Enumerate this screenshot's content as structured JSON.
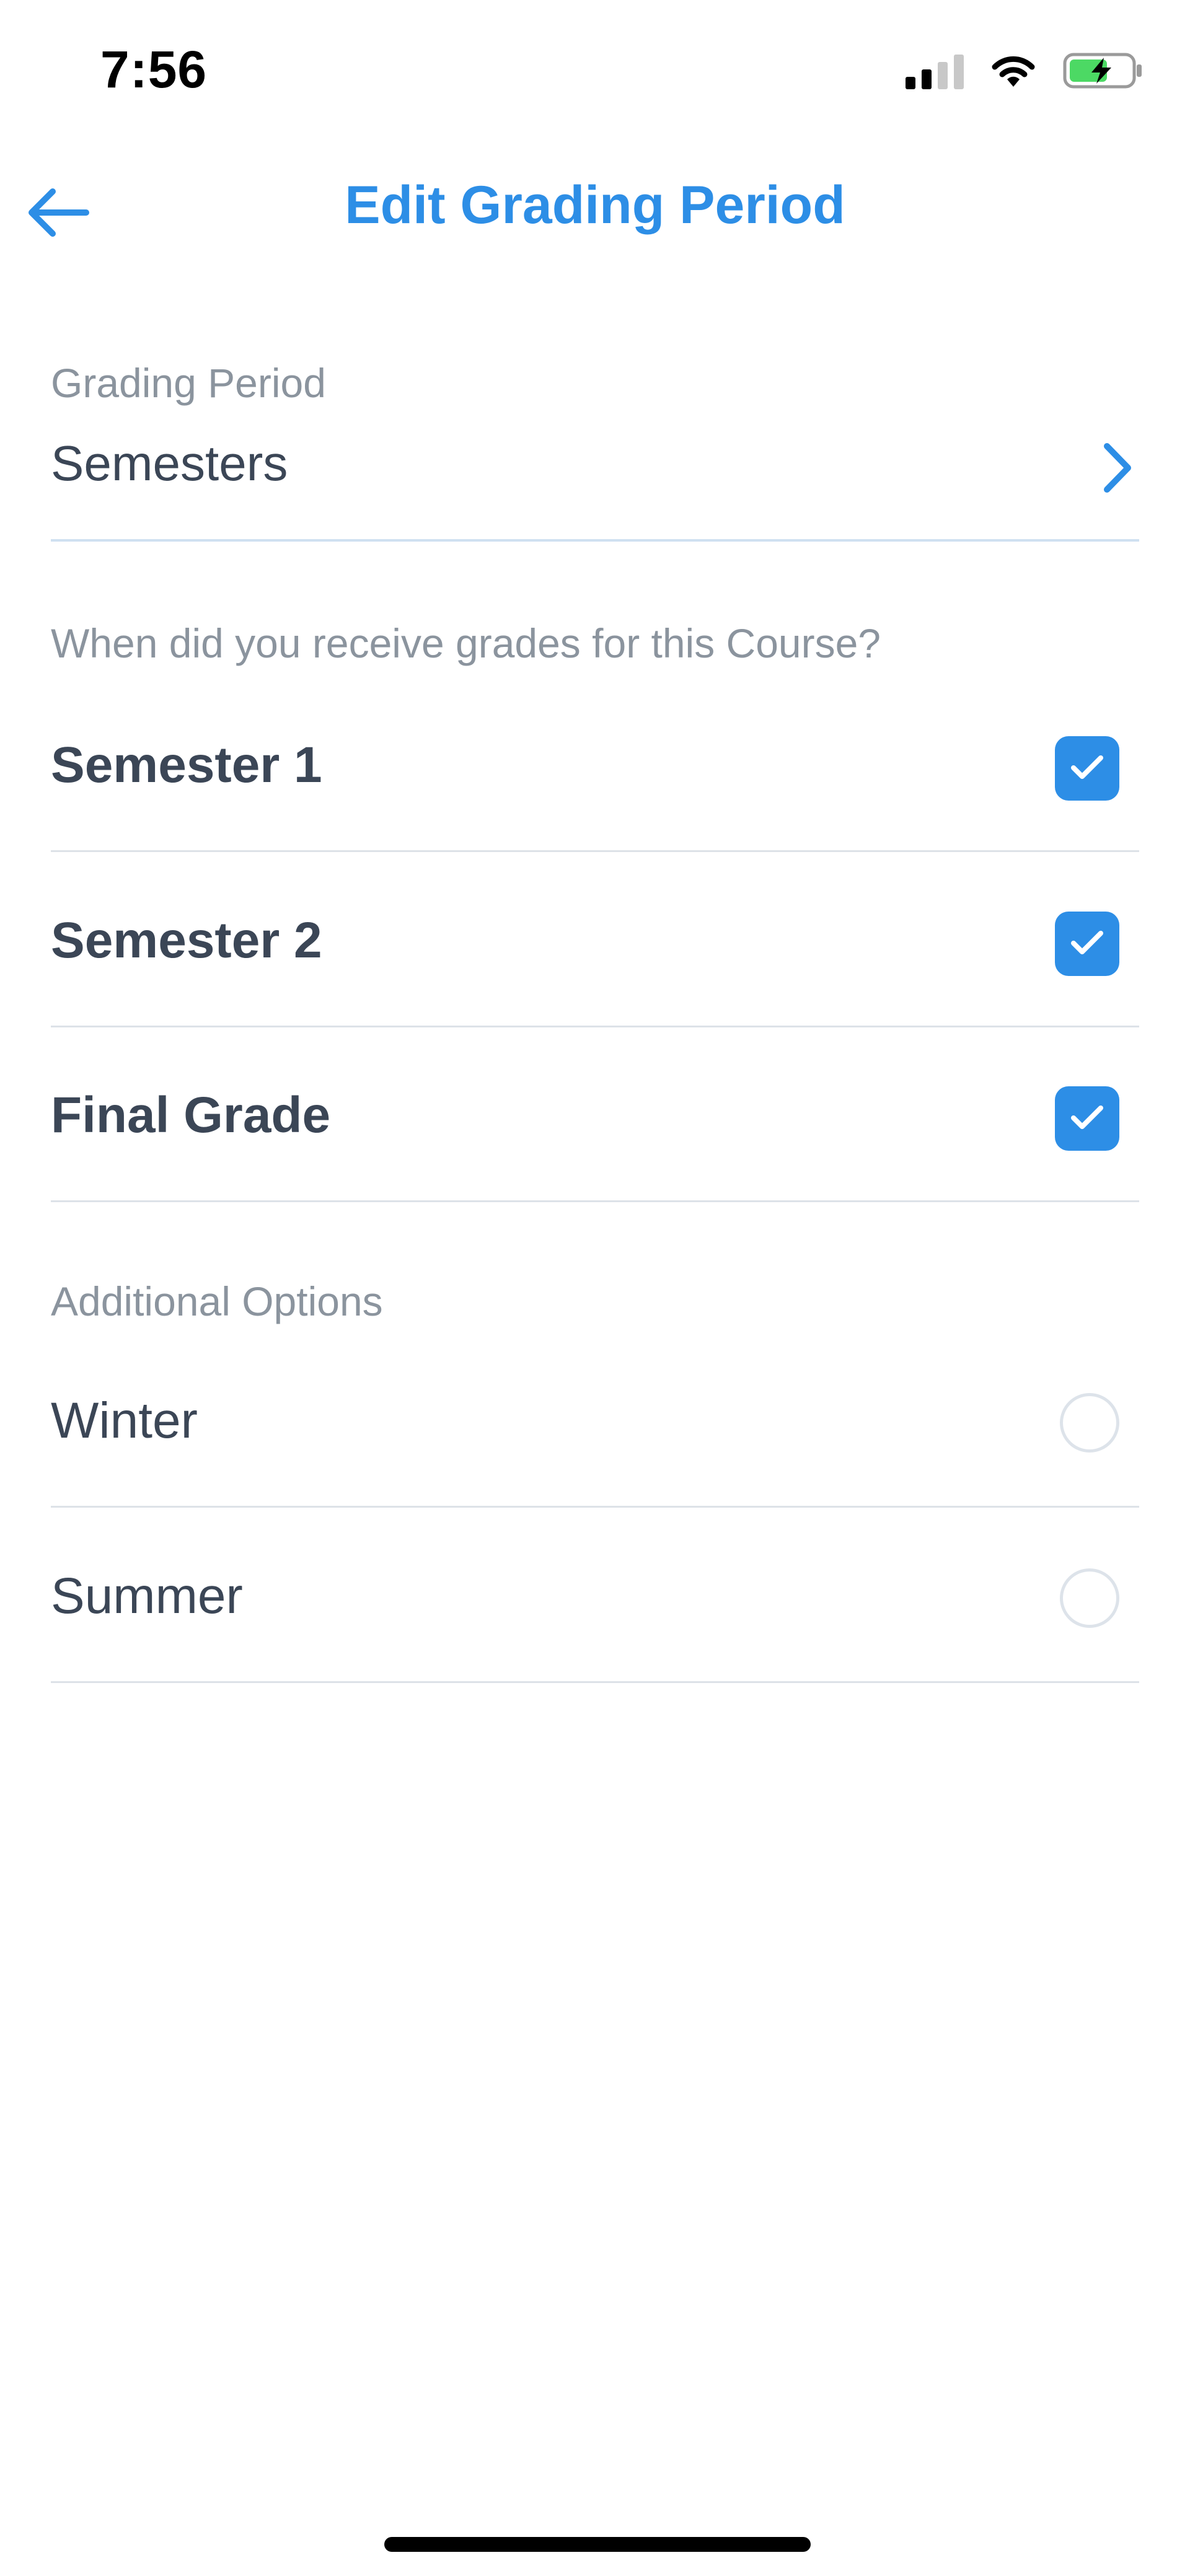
{
  "status_bar": {
    "time": "7:56",
    "signal_icon": "signal-icon",
    "wifi_icon": "wifi-icon",
    "battery_icon": "battery-charging-icon"
  },
  "nav": {
    "back_icon": "arrow-left-icon",
    "title": "Edit Grading Period"
  },
  "grading_period": {
    "label": "Grading Period",
    "value": "Semesters",
    "chevron_icon": "chevron-right-icon"
  },
  "grades_section": {
    "question": "When did you receive grades for this Course?",
    "items": [
      {
        "label": "Semester 1",
        "checked": true
      },
      {
        "label": "Semester 2",
        "checked": true
      },
      {
        "label": "Final Grade",
        "checked": true
      }
    ]
  },
  "additional_section": {
    "label": "Additional Options",
    "items": [
      {
        "label": "Winter",
        "selected": false
      },
      {
        "label": "Summer",
        "selected": false
      }
    ]
  },
  "colors": {
    "accent": "#2d8ee6",
    "text": "#3b4656",
    "muted": "#8b949e",
    "divider": "#dde2e8"
  }
}
